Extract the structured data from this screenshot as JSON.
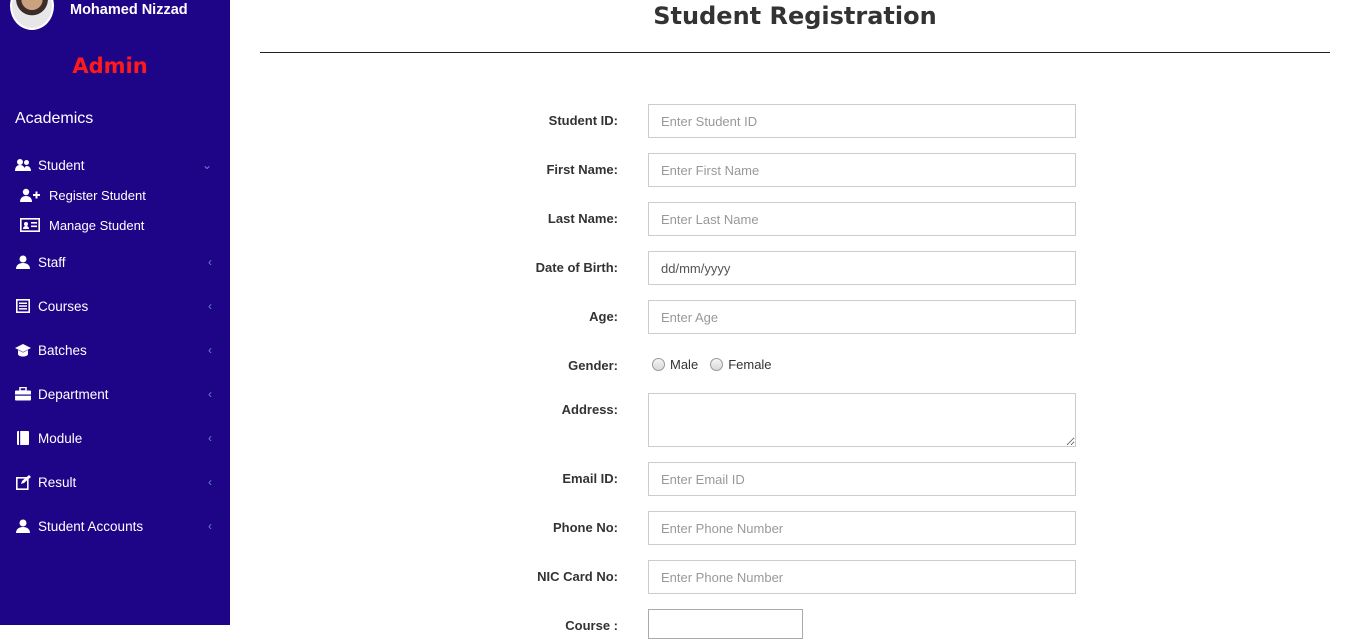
{
  "sidebar": {
    "user_name": "Mohamed Nizzad",
    "role": "Admin",
    "section_heading": "Academics",
    "menu": [
      {
        "label": "Student",
        "icon": "users-icon",
        "expanded": true
      },
      {
        "label": "Staff",
        "icon": "user-icon"
      },
      {
        "label": "Courses",
        "icon": "list-icon"
      },
      {
        "label": "Batches",
        "icon": "graduation-cap-icon"
      },
      {
        "label": "Department",
        "icon": "briefcase-icon"
      },
      {
        "label": "Module",
        "icon": "book-icon"
      },
      {
        "label": "Result",
        "icon": "edit-icon"
      },
      {
        "label": "Student Accounts",
        "icon": "user-icon"
      }
    ],
    "student_submenu": [
      {
        "label": "Register Student",
        "icon": "user-plus-icon"
      },
      {
        "label": "Manage Student",
        "icon": "id-card-icon"
      }
    ]
  },
  "main": {
    "title": "Student Registration",
    "form": {
      "student_id": {
        "label": "Student ID:",
        "placeholder": "Enter Student ID"
      },
      "first_name": {
        "label": "First Name:",
        "placeholder": "Enter First Name"
      },
      "last_name": {
        "label": "Last Name:",
        "placeholder": "Enter Last Name"
      },
      "dob": {
        "label": "Date of Birth:",
        "value": "dd/mm/yyyy"
      },
      "age": {
        "label": "Age:",
        "placeholder": "Enter Age"
      },
      "gender": {
        "label": "Gender:",
        "options": [
          "Male",
          "Female"
        ]
      },
      "address": {
        "label": "Address:"
      },
      "email": {
        "label": "Email ID:",
        "placeholder": "Enter Email ID"
      },
      "phone": {
        "label": "Phone No:",
        "placeholder": "Enter Phone Number"
      },
      "nic": {
        "label": "NIC Card No:",
        "placeholder": "Enter Phone Number"
      },
      "course": {
        "label": "Course :"
      }
    }
  }
}
